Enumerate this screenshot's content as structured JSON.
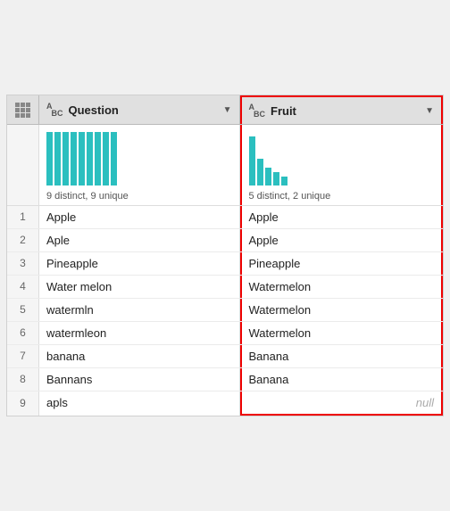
{
  "header": {
    "grid_icon": "grid",
    "col1": {
      "type_icon": "ABC",
      "label": "Question",
      "dropdown": "▼"
    },
    "col2": {
      "type_icon": "ABC",
      "label": "Fruit",
      "dropdown": "▼"
    }
  },
  "histogram": {
    "col1": {
      "stat": "9 distinct, 9 unique",
      "bars": [
        60,
        60,
        60,
        60,
        60,
        60,
        60,
        60,
        60
      ]
    },
    "col2": {
      "stat": "5 distinct, 2 unique",
      "bars": [
        55,
        30,
        20,
        15,
        10
      ]
    }
  },
  "rows": [
    {
      "num": "1",
      "question": "Apple",
      "fruit": "Apple"
    },
    {
      "num": "2",
      "question": "Aple",
      "fruit": "Apple"
    },
    {
      "num": "3",
      "question": "Pineapple",
      "fruit": "Pineapple"
    },
    {
      "num": "4",
      "question": "Water melon",
      "fruit": "Watermelon"
    },
    {
      "num": "5",
      "question": "watermln",
      "fruit": "Watermelon"
    },
    {
      "num": "6",
      "question": "watermleon",
      "fruit": "Watermelon"
    },
    {
      "num": "7",
      "question": "banana",
      "fruit": "Banana"
    },
    {
      "num": "8",
      "question": "Bannans",
      "fruit": "Banana"
    },
    {
      "num": "9",
      "question": "apls",
      "fruit": "null"
    }
  ]
}
